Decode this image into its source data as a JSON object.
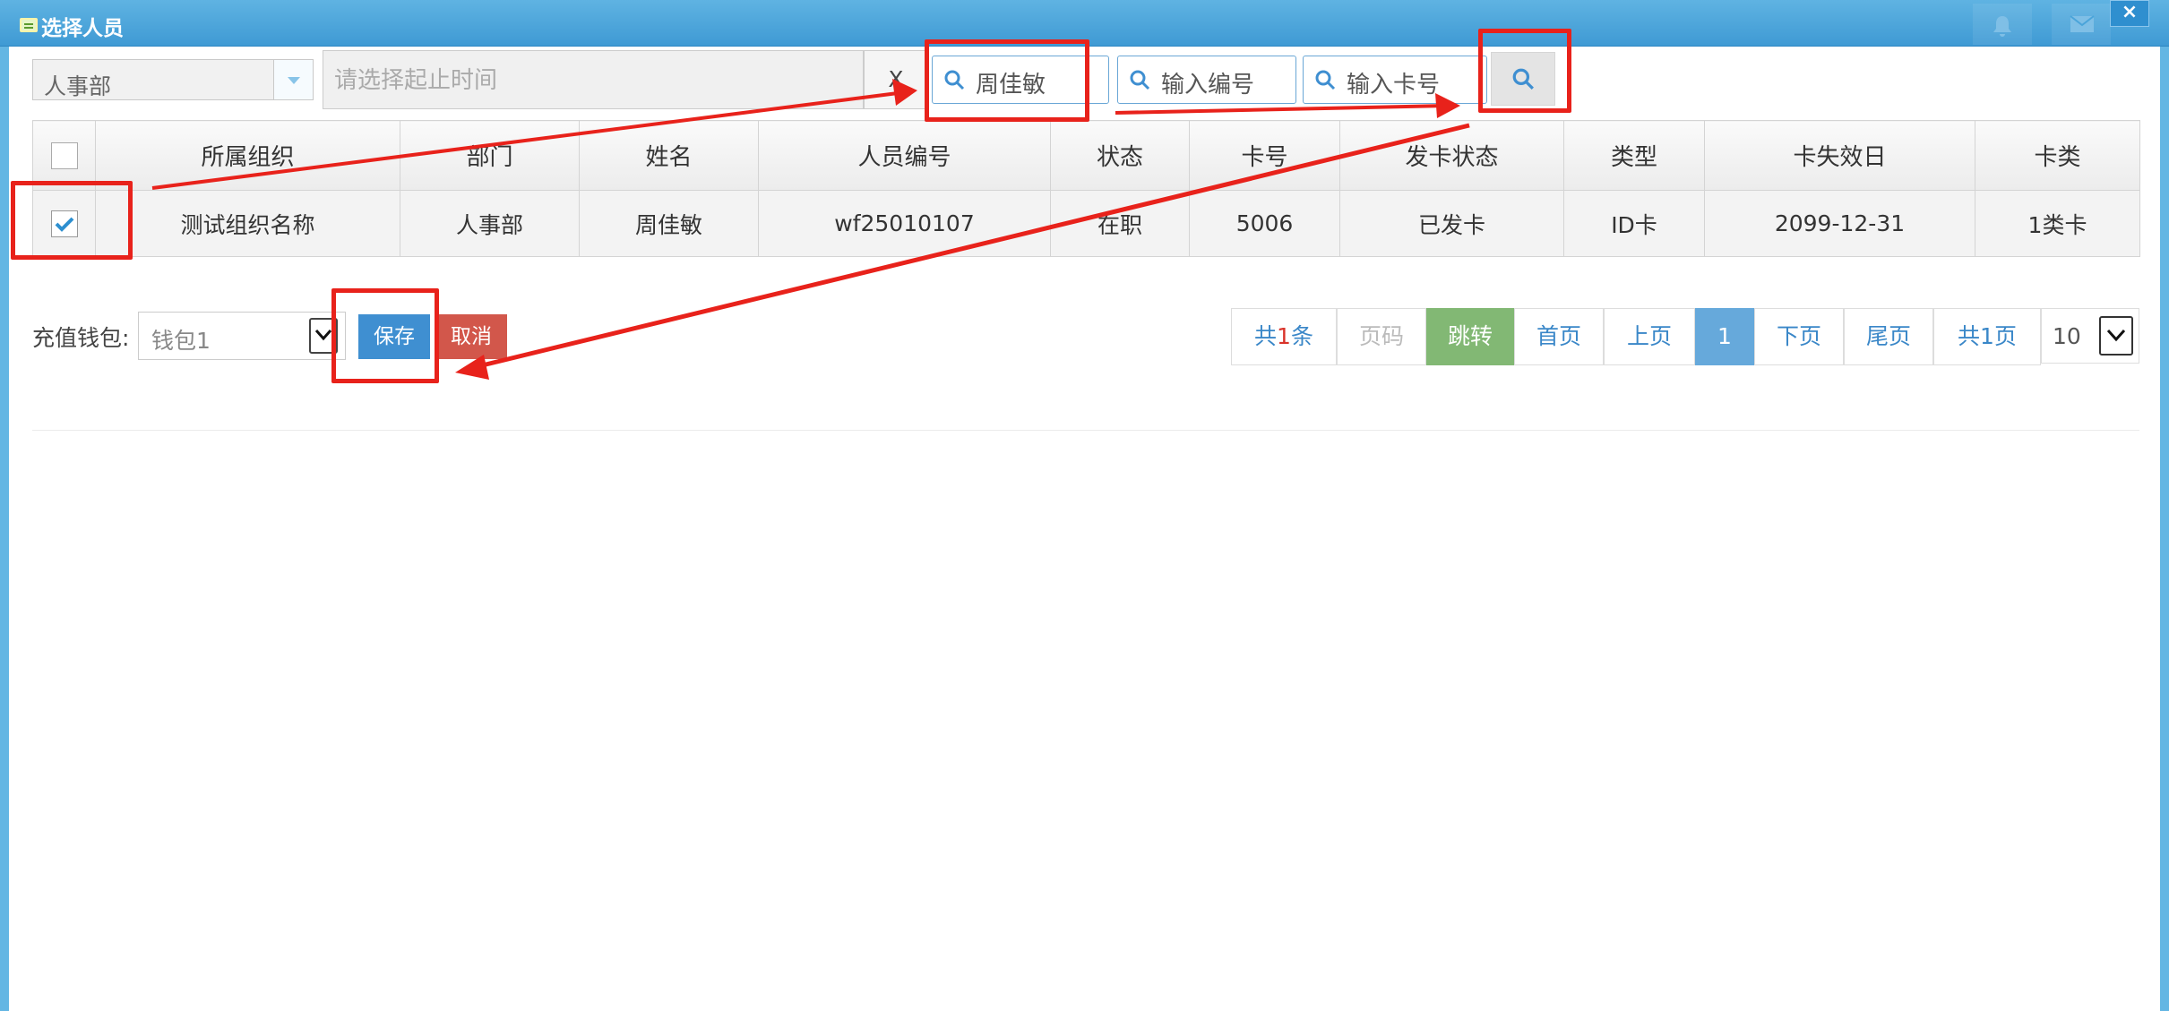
{
  "window": {
    "title": "选择人员",
    "close_label": "×"
  },
  "toolbar": {
    "department_value": "人事部",
    "date_placeholder": "请选择起止时间",
    "clear_label": "X",
    "name_search_value": "周佳敏",
    "code_search_placeholder": "输入编号",
    "card_search_placeholder": "输入卡号"
  },
  "table": {
    "headers": [
      "所属组织",
      "部门",
      "姓名",
      "人员编号",
      "状态",
      "卡号",
      "发卡状态",
      "类型",
      "卡失效日",
      "卡类"
    ],
    "rows": [
      {
        "checked": true,
        "cells": [
          "测试组织名称",
          "人事部",
          "周佳敏",
          "wf25010107",
          "在职",
          "5006",
          "已发卡",
          "ID卡",
          "2099-12-31",
          "1类卡"
        ]
      }
    ]
  },
  "wallet": {
    "label": "充值钱包:",
    "value": "钱包1"
  },
  "actions": {
    "save_label": "保存",
    "cancel_label": "取消"
  },
  "pager": {
    "total_prefix": "共",
    "total_count": "1",
    "total_suffix": "条",
    "page_placeholder": "页码",
    "jump_label": "跳转",
    "first_label": "首页",
    "prev_label": "上页",
    "current_page": "1",
    "next_label": "下页",
    "last_label": "尾页",
    "total_pages_label": "共1页",
    "page_size": "10"
  },
  "colors": {
    "titlebar": "#4aa4da",
    "save_button": "#3f8fd1",
    "cancel_button": "#d2574b",
    "jump_button": "#82b874",
    "current_page": "#66a9db",
    "annotation": "#e8221b"
  }
}
